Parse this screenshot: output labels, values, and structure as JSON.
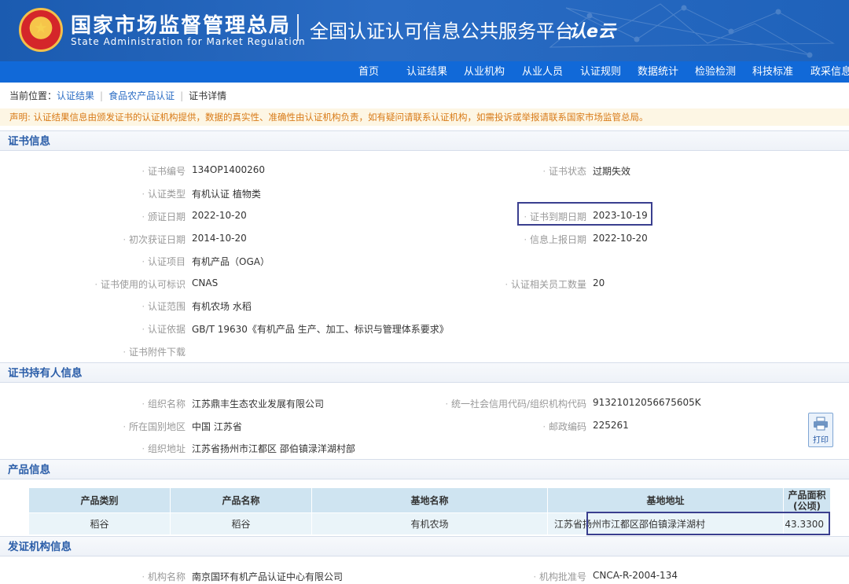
{
  "header": {
    "title_cn": "国家市场监督管理总局",
    "title_en": "State Administration  for  Market Regulation",
    "platform": "全国认证认可信息公共服务平台",
    "logo_text": "认e云"
  },
  "nav": [
    "首页",
    "认证结果",
    "从业机构",
    "从业人员",
    "认证规则",
    "数据统计",
    "检验检测",
    "科技标准",
    "政采信息"
  ],
  "breadcrumb": {
    "prefix": "当前位置：",
    "items": [
      "认证结果",
      "食品农产品认证",
      "证书详情"
    ]
  },
  "notice": "声明: 认证结果信息由颁发证书的认证机构提供，数据的真实性、准确性由认证机构负责，如有疑问请联系认证机构，如需投诉或举报请联系国家市场监管总局。",
  "cert": {
    "section_title": "证书信息",
    "number_label": "证书编号",
    "number": "134OP1400260",
    "status_label": "证书状态",
    "status": "过期失效",
    "type_label": "认证类型",
    "type": "有机认证  植物类",
    "issue_label": "颁证日期",
    "issue": "2022-10-20",
    "expire_label": "证书到期日期",
    "expire": "2023-10-19",
    "first_label": "初次获证日期",
    "first": "2014-10-20",
    "report_label": "信息上报日期",
    "report": "2022-10-20",
    "item_label": "认证项目",
    "item": "有机产品（OGA）",
    "mark_label": "证书使用的认可标识",
    "mark": "CNAS",
    "staff_label": "认证相关员工数量",
    "staff": "20",
    "scope_label": "认证范围",
    "scope": "有机农场 水稻",
    "basis_label": "认证依据",
    "basis": "GB/T 19630《有机产品 生产、加工、标识与管理体系要求》",
    "attach_label": "证书附件下载"
  },
  "holder": {
    "section_title": "证书持有人信息",
    "org_label": "组织名称",
    "org": "江苏鼎丰生态农业发展有限公司",
    "code_label": "统一社会信用代码/组织机构代码",
    "code": "91321012056675605K",
    "region_label": "所在国别地区",
    "region": "中国 江苏省",
    "zip_label": "邮政编码",
    "zip": "225261",
    "addr_label": "组织地址",
    "addr": "江苏省扬州市江都区 邵伯镇渌洋湖村部",
    "print_label": "打印"
  },
  "product": {
    "section_title": "产品信息",
    "headers": [
      "产品类别",
      "产品名称",
      "基地名称",
      "基地地址",
      "产品面积",
      "(公顷)"
    ],
    "row": [
      "稻谷",
      "稻谷",
      "有机农场",
      "江苏省扬州市江都区邵伯镇渌洋湖村",
      "43.3300"
    ]
  },
  "issuer": {
    "section_title": "发证机构信息",
    "name_label": "机构名称",
    "name": "南京国环有机产品认证中心有限公司",
    "approval_label": "机构批准号",
    "approval": "CNCA-R-2004-134"
  },
  "colors": {
    "header_blue": "#1b5bb0",
    "nav_blue": "#1169d8",
    "section_blue": "#2a5da8",
    "notice_orange": "#d87a17",
    "highlight": "#3a3f8f"
  },
  "icons": [
    "national-emblem-icon",
    "printer-icon"
  ]
}
